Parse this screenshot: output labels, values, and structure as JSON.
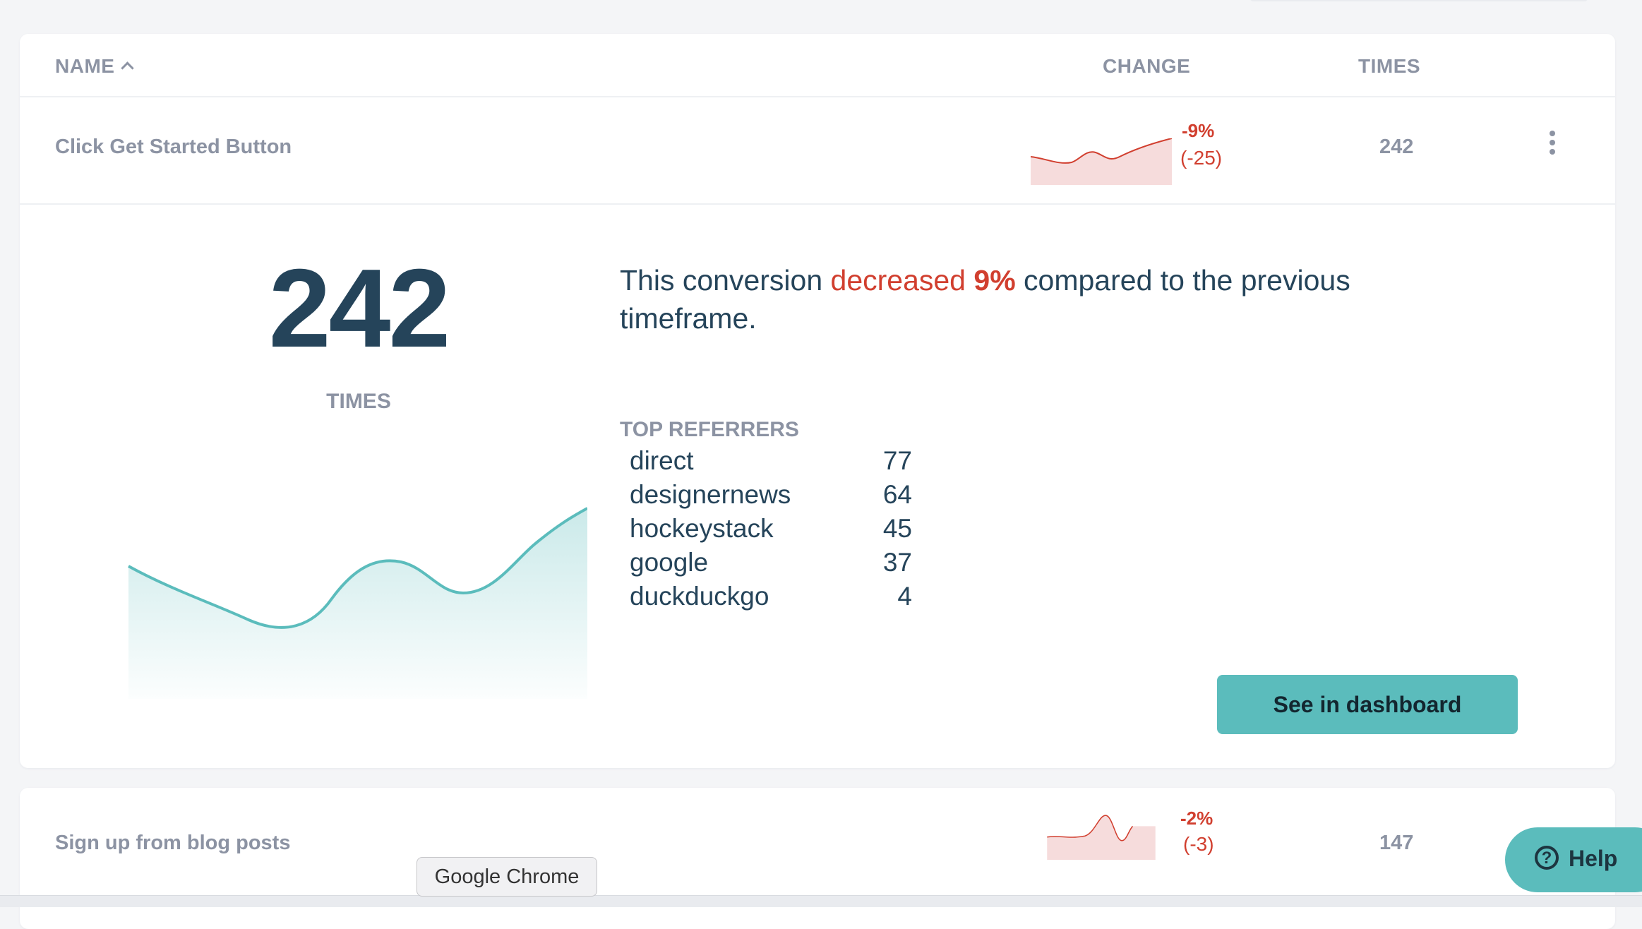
{
  "table": {
    "headers": {
      "name": "NAME",
      "change": "CHANGE",
      "times": "TIMES"
    },
    "sort_icon": "chevron-up-icon",
    "rows": [
      {
        "name": "Click Get Started Button",
        "change_pct": "-9%",
        "change_abs": "(-25)",
        "times": "242"
      },
      {
        "name": "Sign up from blog posts",
        "change_pct": "-2%",
        "change_abs": "(-3)",
        "times": "147"
      }
    ]
  },
  "detail": {
    "big_number": "242",
    "big_label": "TIMES",
    "sentence": {
      "pre": "This conversion ",
      "verb": "decreased",
      "space": " ",
      "pct": "9%",
      "post": " compared to the previous timeframe."
    },
    "referrers_title": "TOP REFERRERS",
    "referrers": [
      {
        "name": "direct",
        "value": "77"
      },
      {
        "name": "designernews",
        "value": "64"
      },
      {
        "name": "hockeystack",
        "value": "45"
      },
      {
        "name": "google",
        "value": "37"
      },
      {
        "name": "duckduckgo",
        "value": "4"
      }
    ],
    "button_label": "See in dashboard"
  },
  "tooltip": "Google Chrome",
  "help_label": "Help",
  "colors": {
    "accent": "#5bbcbc",
    "negative": "#d13f2f",
    "text_dark": "#25445a",
    "muted": "#8c93a3"
  }
}
